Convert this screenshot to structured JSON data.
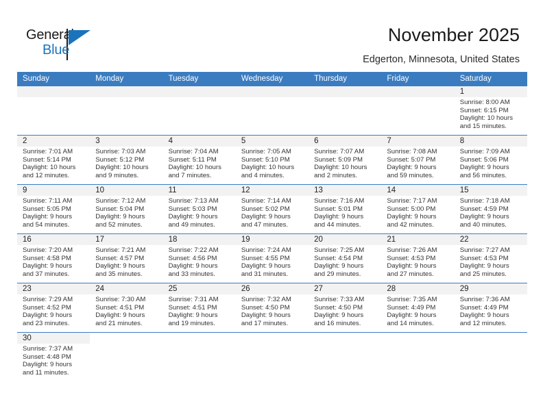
{
  "brand": {
    "name_part1": "General",
    "name_part2": "Blue",
    "logo_icon": "triangle-flag-icon",
    "accent_color": "#1b74bb"
  },
  "header": {
    "title": "November 2025",
    "location": "Edgerton, Minnesota, United States"
  },
  "calendar": {
    "header_color": "#3b7cc0",
    "daynum_band_color": "#f2f2f2",
    "weekdays": [
      "Sunday",
      "Monday",
      "Tuesday",
      "Wednesday",
      "Thursday",
      "Friday",
      "Saturday"
    ],
    "weeks": [
      [
        {
          "day": "",
          "empty": true
        },
        {
          "day": "",
          "empty": true
        },
        {
          "day": "",
          "empty": true
        },
        {
          "day": "",
          "empty": true
        },
        {
          "day": "",
          "empty": true
        },
        {
          "day": "",
          "empty": true
        },
        {
          "day": "1",
          "sunrise": "Sunrise: 8:00 AM",
          "sunset": "Sunset: 6:15 PM",
          "daylight1": "Daylight: 10 hours",
          "daylight2": "and 15 minutes."
        }
      ],
      [
        {
          "day": "2",
          "sunrise": "Sunrise: 7:01 AM",
          "sunset": "Sunset: 5:14 PM",
          "daylight1": "Daylight: 10 hours",
          "daylight2": "and 12 minutes."
        },
        {
          "day": "3",
          "sunrise": "Sunrise: 7:03 AM",
          "sunset": "Sunset: 5:12 PM",
          "daylight1": "Daylight: 10 hours",
          "daylight2": "and 9 minutes."
        },
        {
          "day": "4",
          "sunrise": "Sunrise: 7:04 AM",
          "sunset": "Sunset: 5:11 PM",
          "daylight1": "Daylight: 10 hours",
          "daylight2": "and 7 minutes."
        },
        {
          "day": "5",
          "sunrise": "Sunrise: 7:05 AM",
          "sunset": "Sunset: 5:10 PM",
          "daylight1": "Daylight: 10 hours",
          "daylight2": "and 4 minutes."
        },
        {
          "day": "6",
          "sunrise": "Sunrise: 7:07 AM",
          "sunset": "Sunset: 5:09 PM",
          "daylight1": "Daylight: 10 hours",
          "daylight2": "and 2 minutes."
        },
        {
          "day": "7",
          "sunrise": "Sunrise: 7:08 AM",
          "sunset": "Sunset: 5:07 PM",
          "daylight1": "Daylight: 9 hours",
          "daylight2": "and 59 minutes."
        },
        {
          "day": "8",
          "sunrise": "Sunrise: 7:09 AM",
          "sunset": "Sunset: 5:06 PM",
          "daylight1": "Daylight: 9 hours",
          "daylight2": "and 56 minutes."
        }
      ],
      [
        {
          "day": "9",
          "sunrise": "Sunrise: 7:11 AM",
          "sunset": "Sunset: 5:05 PM",
          "daylight1": "Daylight: 9 hours",
          "daylight2": "and 54 minutes."
        },
        {
          "day": "10",
          "sunrise": "Sunrise: 7:12 AM",
          "sunset": "Sunset: 5:04 PM",
          "daylight1": "Daylight: 9 hours",
          "daylight2": "and 52 minutes."
        },
        {
          "day": "11",
          "sunrise": "Sunrise: 7:13 AM",
          "sunset": "Sunset: 5:03 PM",
          "daylight1": "Daylight: 9 hours",
          "daylight2": "and 49 minutes."
        },
        {
          "day": "12",
          "sunrise": "Sunrise: 7:14 AM",
          "sunset": "Sunset: 5:02 PM",
          "daylight1": "Daylight: 9 hours",
          "daylight2": "and 47 minutes."
        },
        {
          "day": "13",
          "sunrise": "Sunrise: 7:16 AM",
          "sunset": "Sunset: 5:01 PM",
          "daylight1": "Daylight: 9 hours",
          "daylight2": "and 44 minutes."
        },
        {
          "day": "14",
          "sunrise": "Sunrise: 7:17 AM",
          "sunset": "Sunset: 5:00 PM",
          "daylight1": "Daylight: 9 hours",
          "daylight2": "and 42 minutes."
        },
        {
          "day": "15",
          "sunrise": "Sunrise: 7:18 AM",
          "sunset": "Sunset: 4:59 PM",
          "daylight1": "Daylight: 9 hours",
          "daylight2": "and 40 minutes."
        }
      ],
      [
        {
          "day": "16",
          "sunrise": "Sunrise: 7:20 AM",
          "sunset": "Sunset: 4:58 PM",
          "daylight1": "Daylight: 9 hours",
          "daylight2": "and 37 minutes."
        },
        {
          "day": "17",
          "sunrise": "Sunrise: 7:21 AM",
          "sunset": "Sunset: 4:57 PM",
          "daylight1": "Daylight: 9 hours",
          "daylight2": "and 35 minutes."
        },
        {
          "day": "18",
          "sunrise": "Sunrise: 7:22 AM",
          "sunset": "Sunset: 4:56 PM",
          "daylight1": "Daylight: 9 hours",
          "daylight2": "and 33 minutes."
        },
        {
          "day": "19",
          "sunrise": "Sunrise: 7:24 AM",
          "sunset": "Sunset: 4:55 PM",
          "daylight1": "Daylight: 9 hours",
          "daylight2": "and 31 minutes."
        },
        {
          "day": "20",
          "sunrise": "Sunrise: 7:25 AM",
          "sunset": "Sunset: 4:54 PM",
          "daylight1": "Daylight: 9 hours",
          "daylight2": "and 29 minutes."
        },
        {
          "day": "21",
          "sunrise": "Sunrise: 7:26 AM",
          "sunset": "Sunset: 4:53 PM",
          "daylight1": "Daylight: 9 hours",
          "daylight2": "and 27 minutes."
        },
        {
          "day": "22",
          "sunrise": "Sunrise: 7:27 AM",
          "sunset": "Sunset: 4:53 PM",
          "daylight1": "Daylight: 9 hours",
          "daylight2": "and 25 minutes."
        }
      ],
      [
        {
          "day": "23",
          "sunrise": "Sunrise: 7:29 AM",
          "sunset": "Sunset: 4:52 PM",
          "daylight1": "Daylight: 9 hours",
          "daylight2": "and 23 minutes."
        },
        {
          "day": "24",
          "sunrise": "Sunrise: 7:30 AM",
          "sunset": "Sunset: 4:51 PM",
          "daylight1": "Daylight: 9 hours",
          "daylight2": "and 21 minutes."
        },
        {
          "day": "25",
          "sunrise": "Sunrise: 7:31 AM",
          "sunset": "Sunset: 4:51 PM",
          "daylight1": "Daylight: 9 hours",
          "daylight2": "and 19 minutes."
        },
        {
          "day": "26",
          "sunrise": "Sunrise: 7:32 AM",
          "sunset": "Sunset: 4:50 PM",
          "daylight1": "Daylight: 9 hours",
          "daylight2": "and 17 minutes."
        },
        {
          "day": "27",
          "sunrise": "Sunrise: 7:33 AM",
          "sunset": "Sunset: 4:50 PM",
          "daylight1": "Daylight: 9 hours",
          "daylight2": "and 16 minutes."
        },
        {
          "day": "28",
          "sunrise": "Sunrise: 7:35 AM",
          "sunset": "Sunset: 4:49 PM",
          "daylight1": "Daylight: 9 hours",
          "daylight2": "and 14 minutes."
        },
        {
          "day": "29",
          "sunrise": "Sunrise: 7:36 AM",
          "sunset": "Sunset: 4:49 PM",
          "daylight1": "Daylight: 9 hours",
          "daylight2": "and 12 minutes."
        }
      ],
      [
        {
          "day": "30",
          "sunrise": "Sunrise: 7:37 AM",
          "sunset": "Sunset: 4:48 PM",
          "daylight1": "Daylight: 9 hours",
          "daylight2": "and 11 minutes."
        },
        {
          "day": "",
          "empty": true,
          "blank": true
        },
        {
          "day": "",
          "empty": true,
          "blank": true
        },
        {
          "day": "",
          "empty": true,
          "blank": true
        },
        {
          "day": "",
          "empty": true,
          "blank": true
        },
        {
          "day": "",
          "empty": true,
          "blank": true
        },
        {
          "day": "",
          "empty": true,
          "blank": true
        }
      ]
    ]
  }
}
